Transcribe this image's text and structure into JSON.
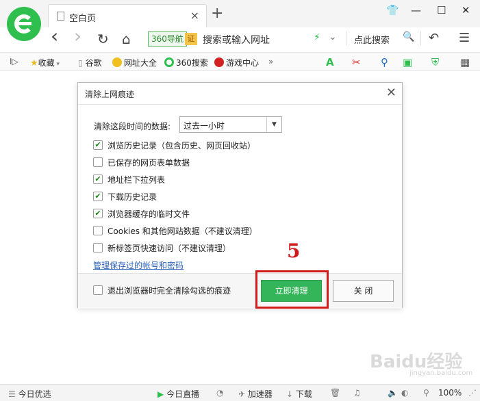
{
  "tab": {
    "title": "空白页",
    "close": "×",
    "new": "+"
  },
  "window": {
    "skin": "👕",
    "minimize": "—",
    "maximize": "☐",
    "close": "✕"
  },
  "nav": {
    "back": "‹",
    "forward": "›",
    "refresh": "↻",
    "home": "⌂",
    "badge": "360导航",
    "cert": "证",
    "address_placeholder": "搜索或输入网址",
    "speed": "⚡",
    "dropdown": "⌄",
    "search_label": "点此搜索",
    "search_icon": "🔍",
    "undo": "↶",
    "menu": "☰"
  },
  "bookmarks": {
    "toggle": "I▷",
    "items": [
      {
        "label": "收藏",
        "icon": "star-icon"
      },
      {
        "label": "谷歌",
        "icon": "page-icon"
      },
      {
        "label": "网址大全",
        "icon": "globe-icon"
      },
      {
        "label": "360搜索",
        "icon": "ring-icon"
      },
      {
        "label": "游戏中心",
        "icon": "game-icon"
      }
    ],
    "more": "»"
  },
  "dialog": {
    "title": "清除上网痕迹",
    "close": "✕",
    "range_label": "清除这段时间的数据:",
    "range_value": "过去一小时",
    "options": [
      {
        "label": "浏览历史记录（包含历史、网页回收站）",
        "checked": true
      },
      {
        "label": "已保存的网页表单数据",
        "checked": false
      },
      {
        "label": "地址栏下拉列表",
        "checked": true
      },
      {
        "label": "下载历史记录",
        "checked": true
      },
      {
        "label": "浏览器缓存的临时文件",
        "checked": true
      },
      {
        "label": "Cookies 和其他网站数据（不建议清理）",
        "checked": false
      },
      {
        "label": "新标签页快速访问（不建议清理）",
        "checked": false
      }
    ],
    "manage_link": "管理保存过的帐号和密码",
    "exit_clear_label": "退出浏览器时完全清除勾选的痕迹",
    "exit_clear_checked": false,
    "clear_button": "立即清理",
    "close_button": "关 闭"
  },
  "annotation": {
    "step": "5",
    "color": "#d11a1a"
  },
  "status": {
    "today": "今日优选",
    "live": "今日直播",
    "accelerator": "加速器",
    "download": "下载",
    "zoom": "100%"
  },
  "watermark": {
    "text": "Baidu经验",
    "sub": "jingyan.baidu.com"
  },
  "colors": {
    "brand_green": "#2fbf4f",
    "clear_button": "#34b55a",
    "link": "#2a62b8"
  }
}
